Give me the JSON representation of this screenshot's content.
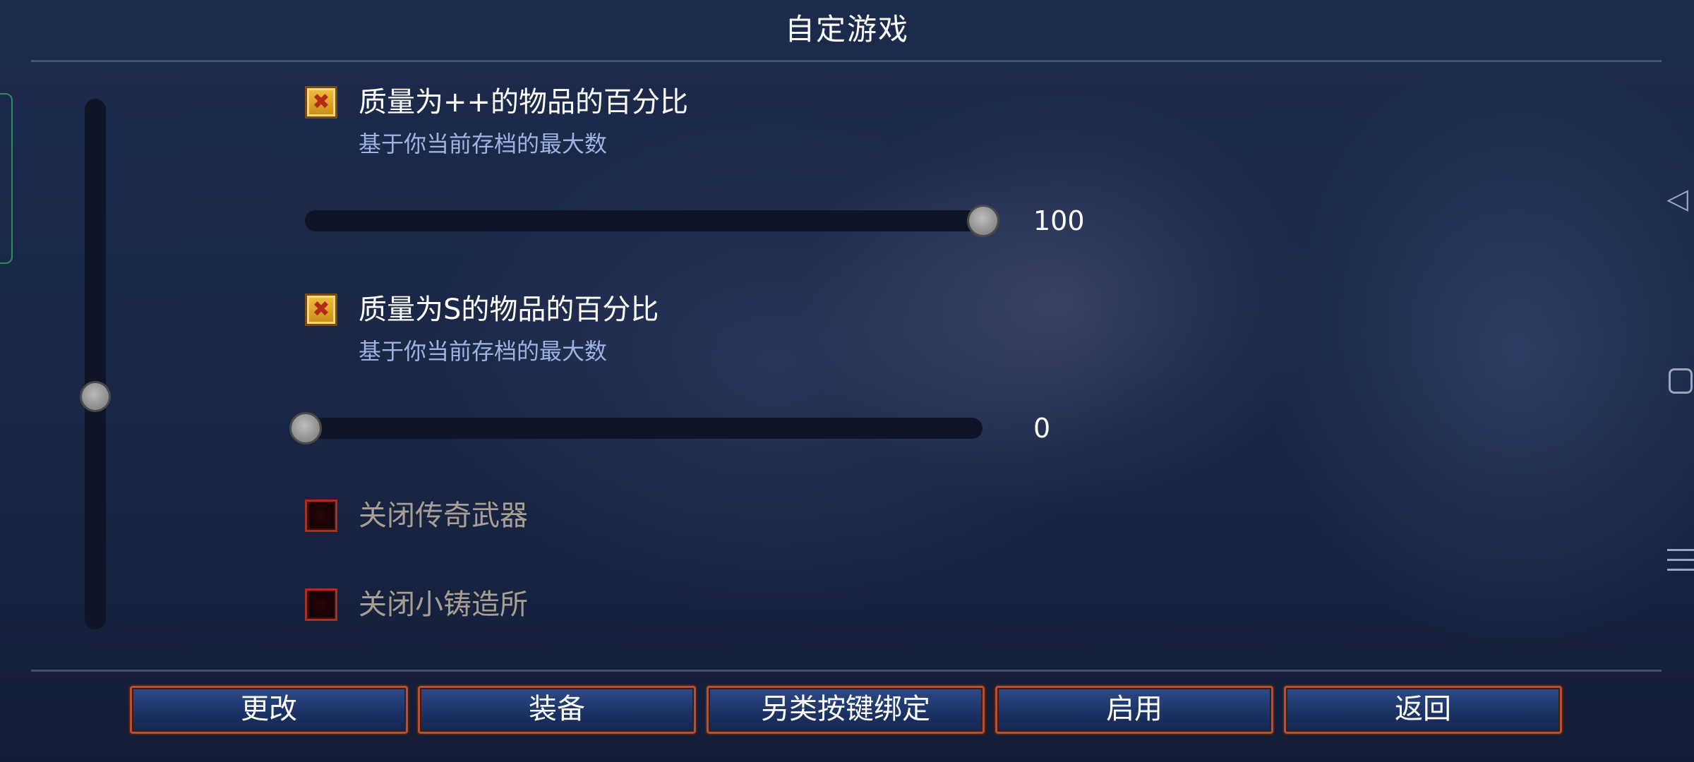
{
  "title": "自定游戏",
  "options": [
    {
      "label": "质量为++的物品的百分比",
      "subtitle": "基于你当前存档的最大数",
      "checked": true,
      "slider_value": "100",
      "slider_fraction": 1.0
    },
    {
      "label": "质量为S的物品的百分比",
      "subtitle": "基于你当前存档的最大数",
      "checked": true,
      "slider_value": "0",
      "slider_fraction": 0.0
    },
    {
      "label": "关闭传奇武器",
      "checked": false
    },
    {
      "label": "关闭小铸造所",
      "checked": false
    }
  ],
  "scroll_position_fraction": 0.55,
  "buttons": [
    {
      "label": "更改"
    },
    {
      "label": "装备"
    },
    {
      "label": "另类按键绑定"
    },
    {
      "label": "启用"
    },
    {
      "label": "返回"
    }
  ],
  "icons": {
    "checked": "x-mark-icon",
    "system_back": "triangle-back-icon",
    "system_home": "square-home-icon",
    "system_menu": "hamburger-menu-icon"
  },
  "colors": {
    "checkbox_checked": "#e3a52a",
    "checkbox_unchecked_border": "#a8311f",
    "subtitle": "#9eb3e3",
    "button_border": "#b0523a"
  }
}
